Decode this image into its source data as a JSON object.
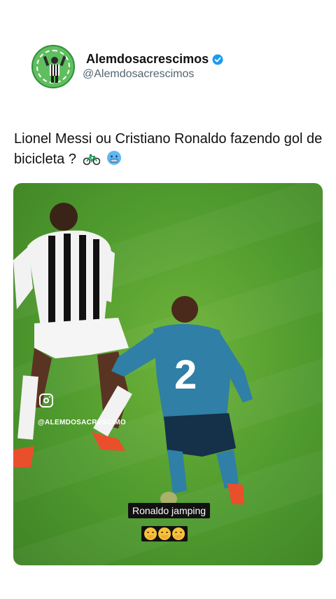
{
  "author": {
    "name": "Alemdosacrescimos",
    "handle": "@Alemdosacrescimos",
    "verified": true,
    "avatar": "referee-logo-avatar"
  },
  "tweet": {
    "text": "Lionel Messi ou Cristiano Ronaldo fazendo gol de bicicleta ?",
    "emojis": [
      "bicycle-emoji",
      "cold-face-emoji"
    ]
  },
  "media": {
    "watermark": "@ALEMDOSACRESCIMO",
    "caption": "Ronaldo jamping",
    "caption_emojis": [
      "hugging-face-emoji",
      "hugging-face-emoji",
      "hugging-face-emoji"
    ],
    "player_numbers": [
      "2"
    ]
  },
  "colors": {
    "verified": "#1d9bf0",
    "pitch": "#4f9a2e",
    "handle": "#536471"
  }
}
